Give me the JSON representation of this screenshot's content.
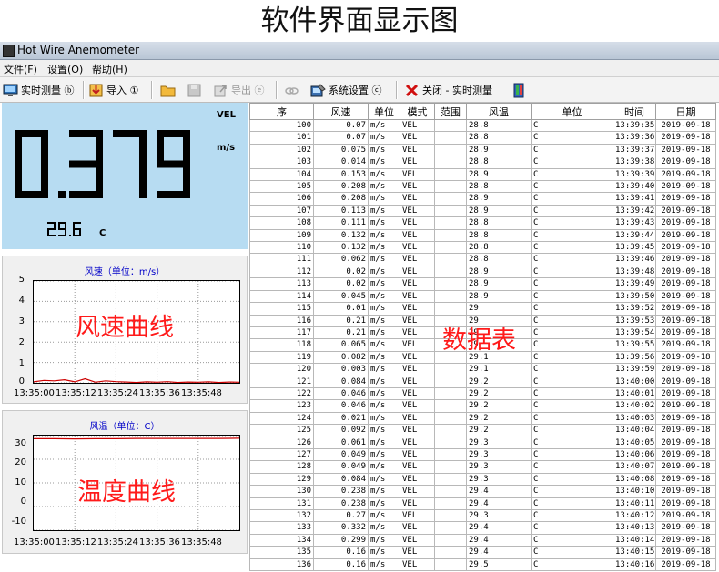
{
  "caption": "软件界面显示图",
  "window": {
    "title": "Hot Wire Anemometer"
  },
  "menu": [
    {
      "label": "文件(F)"
    },
    {
      "label": "设置(O)"
    },
    {
      "label": "帮助(H)"
    }
  ],
  "toolbar": {
    "realtime": "实时测量 ⓑ",
    "import": "导入 ①",
    "export": "导出 ⓔ",
    "system_settings": "系统设置 ⓒ",
    "close_realtime": "关闭 - 实时测量"
  },
  "lcd": {
    "speed_value": "0.379",
    "speed_mode": "VEL",
    "speed_unit": "m/s",
    "temp_value": "29.6",
    "temp_unit": "C"
  },
  "speed_chart": {
    "title": "风速（单位：m/s）",
    "overlay": "风速曲线",
    "yticks": [
      "5",
      "4",
      "3",
      "2",
      "1",
      "0"
    ],
    "xticks": [
      "13:35:00",
      "13:35:12",
      "13:35:24",
      "13:35:36",
      "13:35:48"
    ]
  },
  "temp_chart": {
    "title": "风温（单位：C）",
    "overlay": "温度曲线",
    "yticks": [
      "30",
      "20",
      "10",
      "0",
      "-10"
    ],
    "xticks": [
      "13:35:00",
      "13:35:12",
      "13:35:24",
      "13:35:36",
      "13:35:48"
    ]
  },
  "colors": {
    "lcd_bg": "#b7dcf2",
    "curve": "#cc0000",
    "annotation": "#ff1a1a",
    "chart_title": "#0000c8"
  },
  "chart_data": [
    {
      "type": "line",
      "title": "风速（单位：m/s）",
      "x": [
        "13:35:00",
        "13:35:12",
        "13:35:24",
        "13:35:36",
        "13:35:48"
      ],
      "ylim": [
        0,
        5
      ],
      "series": [
        {
          "values": [
            0.05,
            0.12,
            0.1,
            0.15,
            0.05,
            0.2,
            0.03,
            0.1,
            0.06,
            0.04,
            0.02,
            0.05,
            0.03,
            0.06,
            0.02,
            0.04,
            0.03,
            0.05,
            0.02,
            0.04,
            0.03
          ]
        }
      ]
    },
    {
      "type": "line",
      "title": "风温（单位：C）",
      "x": [
        "13:35:00",
        "13:35:12",
        "13:35:24",
        "13:35:36",
        "13:35:48"
      ],
      "ylim": [
        -10,
        30
      ],
      "series": [
        {
          "values": [
            28.7,
            28.7,
            28.6,
            28.7,
            28.7,
            28.8,
            28.8,
            28.8,
            28.8,
            28.8,
            28.9
          ]
        }
      ]
    }
  ],
  "data_overlay": "数据表",
  "table": {
    "headers": [
      "序",
      "风速",
      "单位",
      "模式",
      "范围",
      "风温",
      "单位",
      "时间",
      "日期"
    ],
    "rows": [
      [
        "100",
        "0.07",
        "m/s",
        "VEL",
        "",
        "28.8",
        "C",
        "13:39:35",
        "2019-09-18"
      ],
      [
        "101",
        "0.07",
        "m/s",
        "VEL",
        "",
        "28.8",
        "C",
        "13:39:36",
        "2019-09-18"
      ],
      [
        "102",
        "0.075",
        "m/s",
        "VEL",
        "",
        "28.9",
        "C",
        "13:39:37",
        "2019-09-18"
      ],
      [
        "103",
        "0.014",
        "m/s",
        "VEL",
        "",
        "28.8",
        "C",
        "13:39:38",
        "2019-09-18"
      ],
      [
        "104",
        "0.153",
        "m/s",
        "VEL",
        "",
        "28.9",
        "C",
        "13:39:39",
        "2019-09-18"
      ],
      [
        "105",
        "0.208",
        "m/s",
        "VEL",
        "",
        "28.8",
        "C",
        "13:39:40",
        "2019-09-18"
      ],
      [
        "106",
        "0.208",
        "m/s",
        "VEL",
        "",
        "28.9",
        "C",
        "13:39:41",
        "2019-09-18"
      ],
      [
        "107",
        "0.113",
        "m/s",
        "VEL",
        "",
        "28.9",
        "C",
        "13:39:42",
        "2019-09-18"
      ],
      [
        "108",
        "0.111",
        "m/s",
        "VEL",
        "",
        "28.8",
        "C",
        "13:39:43",
        "2019-09-18"
      ],
      [
        "109",
        "0.132",
        "m/s",
        "VEL",
        "",
        "28.8",
        "C",
        "13:39:44",
        "2019-09-18"
      ],
      [
        "110",
        "0.132",
        "m/s",
        "VEL",
        "",
        "28.8",
        "C",
        "13:39:45",
        "2019-09-18"
      ],
      [
        "111",
        "0.062",
        "m/s",
        "VEL",
        "",
        "28.8",
        "C",
        "13:39:46",
        "2019-09-18"
      ],
      [
        "112",
        "0.02",
        "m/s",
        "VEL",
        "",
        "28.9",
        "C",
        "13:39:48",
        "2019-09-18"
      ],
      [
        "113",
        "0.02",
        "m/s",
        "VEL",
        "",
        "28.9",
        "C",
        "13:39:49",
        "2019-09-18"
      ],
      [
        "114",
        "0.045",
        "m/s",
        "VEL",
        "",
        "28.9",
        "C",
        "13:39:50",
        "2019-09-18"
      ],
      [
        "115",
        "0.01",
        "m/s",
        "VEL",
        "",
        "29",
        "C",
        "13:39:52",
        "2019-09-18"
      ],
      [
        "116",
        "0.21",
        "m/s",
        "VEL",
        "",
        "29",
        "C",
        "13:39:53",
        "2019-09-18"
      ],
      [
        "117",
        "0.21",
        "m/s",
        "VEL",
        "",
        "29",
        "C",
        "13:39:54",
        "2019-09-18"
      ],
      [
        "118",
        "0.065",
        "m/s",
        "VEL",
        "",
        "29",
        "C",
        "13:39:55",
        "2019-09-18"
      ],
      [
        "119",
        "0.082",
        "m/s",
        "VEL",
        "",
        "29.1",
        "C",
        "13:39:56",
        "2019-09-18"
      ],
      [
        "120",
        "0.003",
        "m/s",
        "VEL",
        "",
        "29.1",
        "C",
        "13:39:59",
        "2019-09-18"
      ],
      [
        "121",
        "0.084",
        "m/s",
        "VEL",
        "",
        "29.2",
        "C",
        "13:40:00",
        "2019-09-18"
      ],
      [
        "122",
        "0.046",
        "m/s",
        "VEL",
        "",
        "29.2",
        "C",
        "13:40:01",
        "2019-09-18"
      ],
      [
        "123",
        "0.046",
        "m/s",
        "VEL",
        "",
        "29.2",
        "C",
        "13:40:02",
        "2019-09-18"
      ],
      [
        "124",
        "0.021",
        "m/s",
        "VEL",
        "",
        "29.2",
        "C",
        "13:40:03",
        "2019-09-18"
      ],
      [
        "125",
        "0.092",
        "m/s",
        "VEL",
        "",
        "29.2",
        "C",
        "13:40:04",
        "2019-09-18"
      ],
      [
        "126",
        "0.061",
        "m/s",
        "VEL",
        "",
        "29.3",
        "C",
        "13:40:05",
        "2019-09-18"
      ],
      [
        "127",
        "0.049",
        "m/s",
        "VEL",
        "",
        "29.3",
        "C",
        "13:40:06",
        "2019-09-18"
      ],
      [
        "128",
        "0.049",
        "m/s",
        "VEL",
        "",
        "29.3",
        "C",
        "13:40:07",
        "2019-09-18"
      ],
      [
        "129",
        "0.084",
        "m/s",
        "VEL",
        "",
        "29.3",
        "C",
        "13:40:08",
        "2019-09-18"
      ],
      [
        "130",
        "0.238",
        "m/s",
        "VEL",
        "",
        "29.4",
        "C",
        "13:40:10",
        "2019-09-18"
      ],
      [
        "131",
        "0.238",
        "m/s",
        "VEL",
        "",
        "29.4",
        "C",
        "13:40:11",
        "2019-09-18"
      ],
      [
        "132",
        "0.27",
        "m/s",
        "VEL",
        "",
        "29.3",
        "C",
        "13:40:12",
        "2019-09-18"
      ],
      [
        "133",
        "0.332",
        "m/s",
        "VEL",
        "",
        "29.4",
        "C",
        "13:40:13",
        "2019-09-18"
      ],
      [
        "134",
        "0.299",
        "m/s",
        "VEL",
        "",
        "29.4",
        "C",
        "13:40:14",
        "2019-09-18"
      ],
      [
        "135",
        "0.16",
        "m/s",
        "VEL",
        "",
        "29.4",
        "C",
        "13:40:15",
        "2019-09-18"
      ],
      [
        "136",
        "0.16",
        "m/s",
        "VEL",
        "",
        "29.5",
        "C",
        "13:40:16",
        "2019-09-18"
      ]
    ]
  }
}
